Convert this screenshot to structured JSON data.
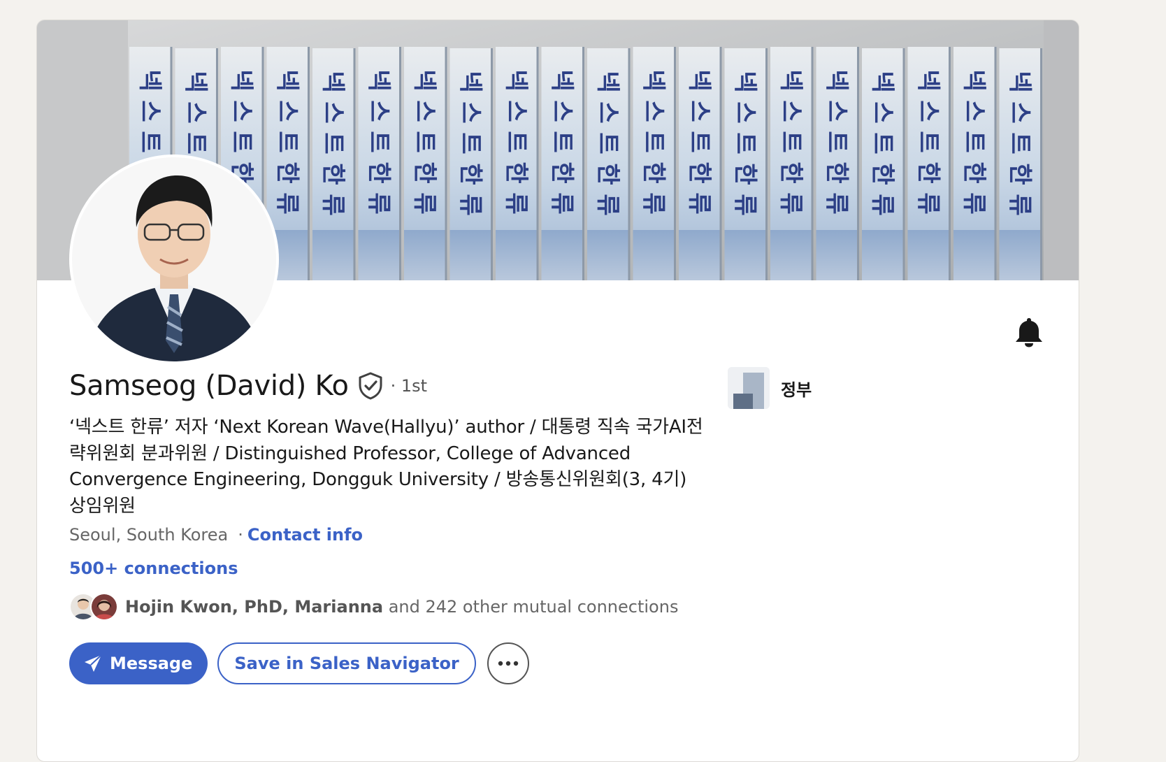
{
  "profile": {
    "name": "Samseog (David) Ko",
    "degree": "· 1st",
    "headline": "‘넥스트 한류’ 저자 ‘Next Korean Wave(Hallyu)’ author / 대통령 직속 국가AI전략위원회 분과위원 / Distinguished Professor, College of Advanced Convergence Engineering, Dongguk University / 방송통신위원회(3, 4기) 상임위원",
    "location": "Seoul, South Korea",
    "location_separator": "·",
    "contact_info": "Contact info",
    "connections": "500+ connections",
    "mutual": {
      "names": "Hojin Kwon, PhD, Marianna",
      "rest": "and 242 other mutual connections"
    }
  },
  "banner": {
    "book_spine_text": [
      "넥",
      "스",
      "트",
      "한",
      "류"
    ]
  },
  "actions": {
    "message": "Message",
    "save": "Save in Sales Navigator",
    "more_icon": "ellipsis-icon"
  },
  "organization": {
    "name": "정부"
  },
  "colors": {
    "accent": "#3b62c7",
    "page_bg": "#f4f2ee",
    "text": "#191919",
    "muted": "#666666"
  }
}
